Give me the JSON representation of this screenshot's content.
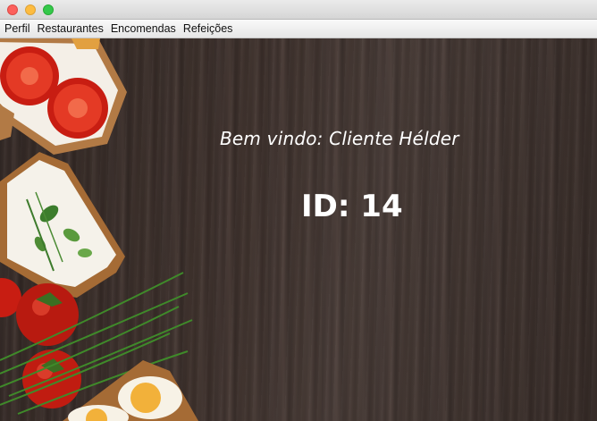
{
  "window": {
    "controls": [
      "close",
      "minimize",
      "maximize"
    ]
  },
  "menu": {
    "items": [
      "Perfil",
      "Restaurantes",
      "Encomendas",
      "Refeições"
    ]
  },
  "main": {
    "welcome_text": "Bem vindo: Cliente Hélder",
    "id_text": "ID: 14",
    "background": "dark-wood-with-food-image"
  },
  "colors": {
    "text": "#ffffff",
    "wood_dark": "#3a2f2b",
    "close": "#fc605c",
    "minimize": "#fdbc40",
    "maximize": "#34c84a"
  }
}
